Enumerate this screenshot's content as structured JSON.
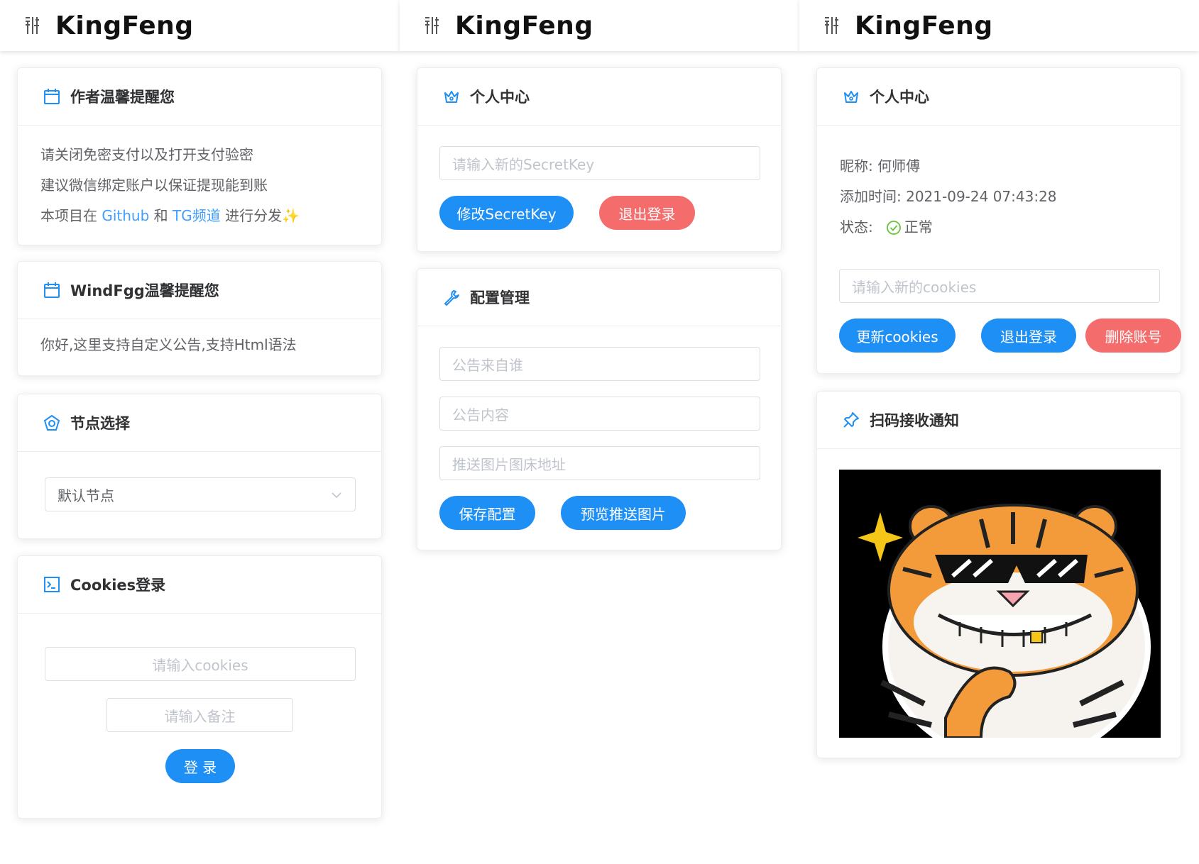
{
  "brand": "KingFeng",
  "colors": {
    "primary": "#1e8ff5",
    "danger": "#f56c6c",
    "link": "#409eff"
  },
  "col1": {
    "author_notice": {
      "title": "作者温馨提醒您",
      "icon": "calendar-icon",
      "lines": [
        "请关闭免密支付以及打开支付验密",
        "建议微信绑定账户以保证提现能到账"
      ],
      "line3_prefix": "本项目在 ",
      "line3_link1": "Github",
      "line3_mid": " 和 ",
      "line3_link2": "TG频道",
      "line3_suffix": " 进行分发",
      "line3_emoji": "✨"
    },
    "admin_notice": {
      "title": "WindFgg温馨提醒您",
      "icon": "calendar-icon",
      "text": "你好,这里支持自定义公告,支持Html语法"
    },
    "node_select": {
      "title": "节点选择",
      "icon": "compass-icon",
      "selected": "默认节点"
    },
    "cookies_login": {
      "title": "Cookies登录",
      "icon": "terminal-icon",
      "cookies_placeholder": "请输入cookies",
      "remark_placeholder": "请输入备注",
      "login_label": "登 录"
    }
  },
  "col2": {
    "personal": {
      "title": "个人中心",
      "icon": "crown-icon",
      "secret_placeholder": "请输入新的SecretKey",
      "modify_label": "修改SecretKey",
      "logout_label": "退出登录"
    },
    "config": {
      "title": "配置管理",
      "icon": "wrench-icon",
      "from_placeholder": "公告来自谁",
      "content_placeholder": "公告内容",
      "image_placeholder": "推送图片图床地址",
      "save_label": "保存配置",
      "preview_label": "预览推送图片"
    }
  },
  "col3": {
    "personal": {
      "title": "个人中心",
      "icon": "crown-icon",
      "nickname_label": "昵称:",
      "nickname": "何师傅",
      "added_label": "添加时间:",
      "added": "2021-09-24 07:43:28",
      "status_label": "状态:",
      "status": "正常",
      "cookies_placeholder": "请输入新的cookies",
      "update_label": "更新cookies",
      "logout_label": "退出登录",
      "delete_label": "删除账号"
    },
    "qr": {
      "title": "扫码接收通知",
      "icon": "pin-icon"
    }
  }
}
